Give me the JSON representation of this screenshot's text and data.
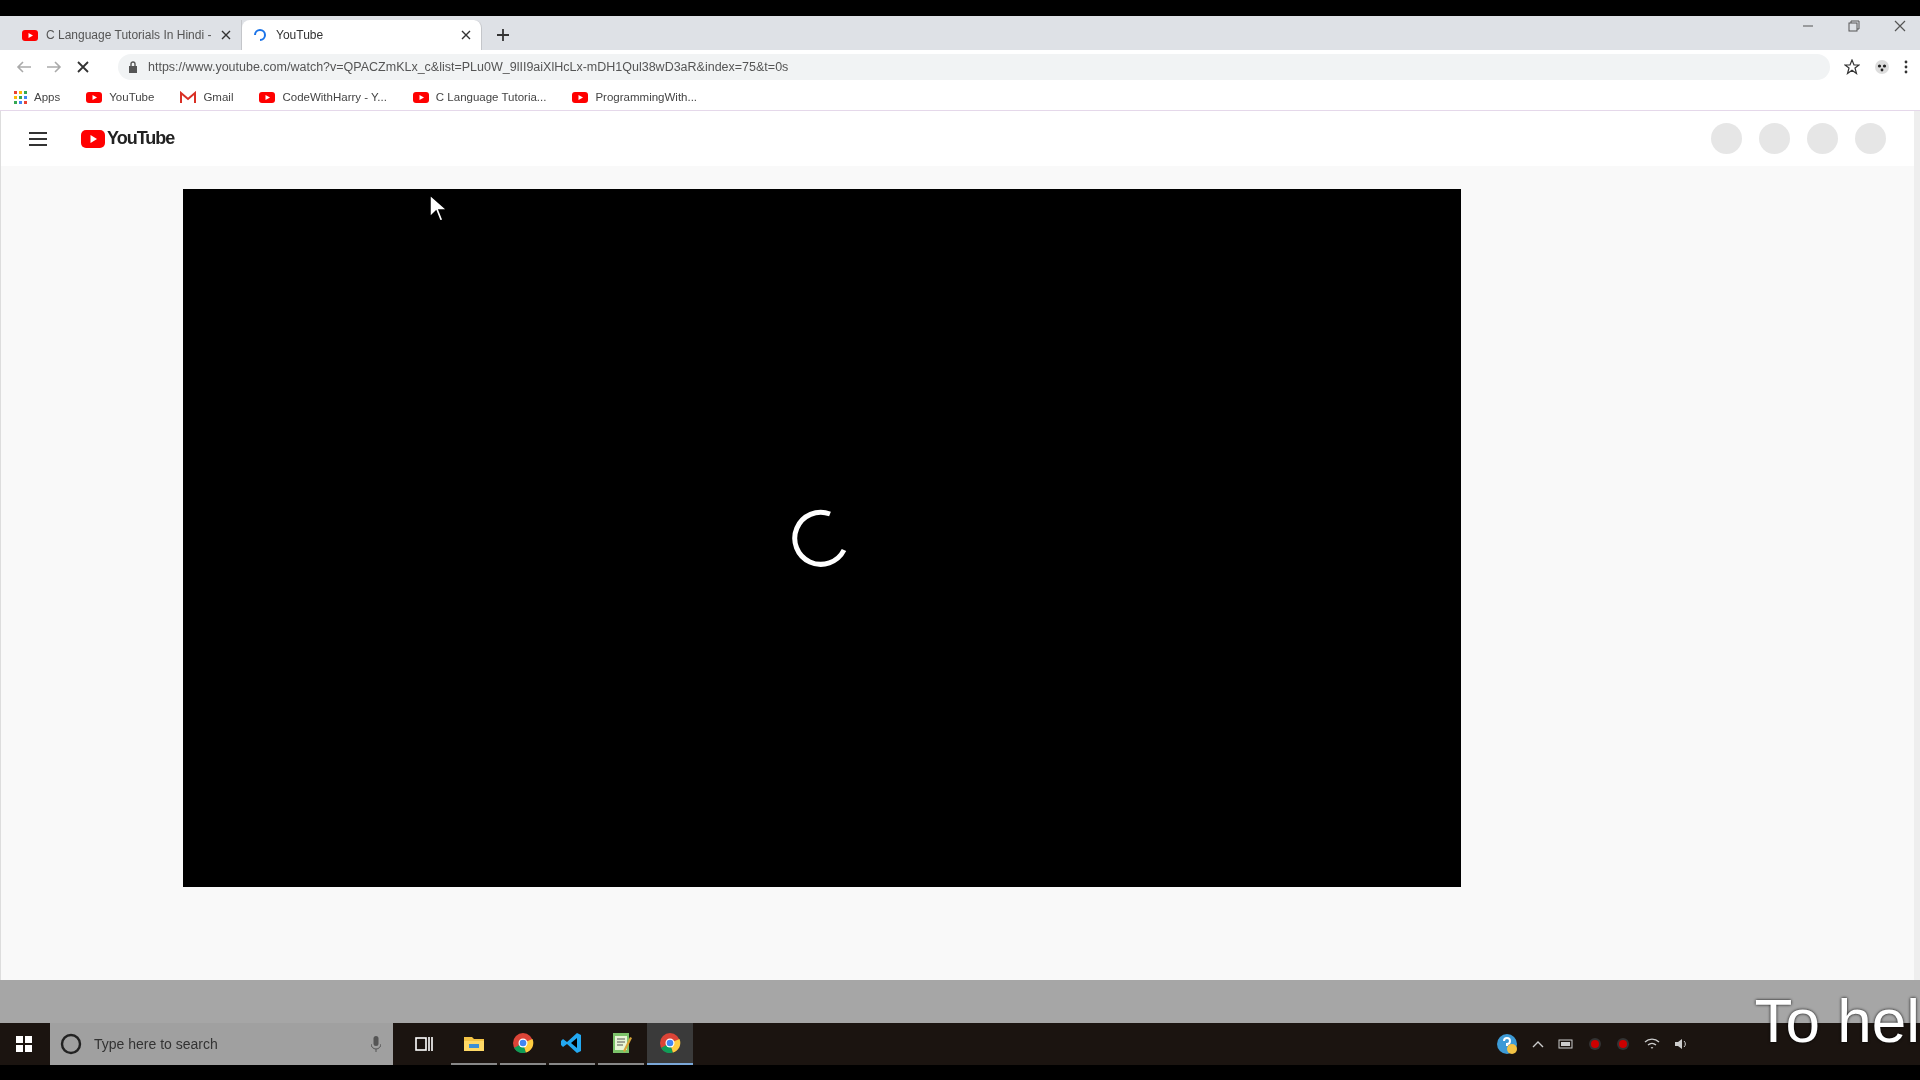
{
  "browser": {
    "tabs": [
      {
        "title": "C Language Tutorials In Hindi -",
        "selected": false,
        "loading": false
      },
      {
        "title": "YouTube",
        "selected": true,
        "loading": true
      }
    ],
    "address": "https://www.youtube.com/watch?v=QPACZmKLx_c&list=PLu0W_9lII9aiXlHcLx-mDH1Qul38wD3aR&index=75&t=0s",
    "bookmarks": [
      {
        "label": "Apps",
        "kind": "apps"
      },
      {
        "label": "YouTube",
        "kind": "youtube"
      },
      {
        "label": "Gmail",
        "kind": "gmail"
      },
      {
        "label": "CodeWithHarry - Y...",
        "kind": "youtube"
      },
      {
        "label": "C Language Tutoria...",
        "kind": "youtube"
      },
      {
        "label": "ProgrammingWith...",
        "kind": "youtube"
      }
    ]
  },
  "page": {
    "logo": "YouTube",
    "video": {
      "loading": true
    }
  },
  "taskbar": {
    "search": {
      "placeholder": "Type here to search"
    },
    "apps": [
      {
        "kind": "explorer",
        "running": true
      },
      {
        "kind": "chrome",
        "running": true
      },
      {
        "kind": "vscode",
        "running": true
      },
      {
        "kind": "notepad",
        "running": true
      },
      {
        "kind": "chrome",
        "running": true,
        "selected": true
      }
    ]
  },
  "caption": "To hel"
}
